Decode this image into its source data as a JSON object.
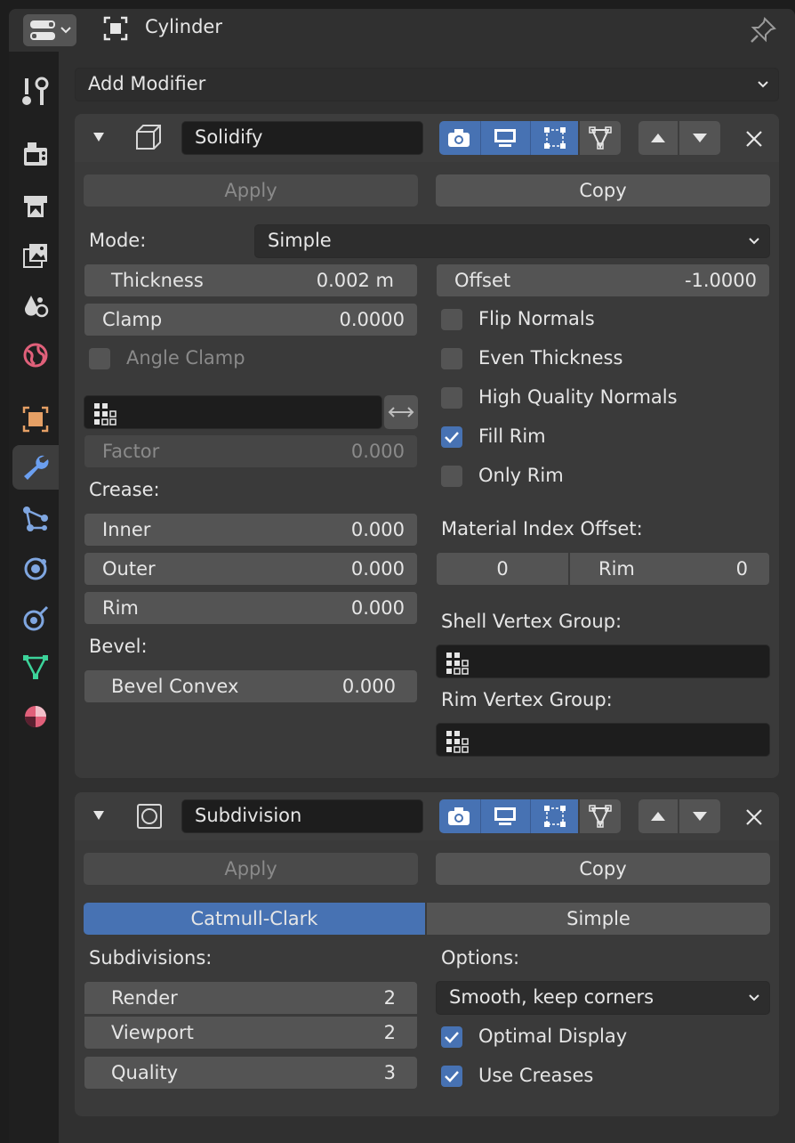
{
  "header": {
    "object_name": "Cylinder"
  },
  "add_modifier": {
    "label": "Add Modifier"
  },
  "solidify": {
    "name": "Solidify",
    "apply_label": "Apply",
    "copy_label": "Copy",
    "mode_label": "Mode:",
    "mode_value": "Simple",
    "thickness_label": "Thickness",
    "thickness_value": "0.002 m",
    "offset_label": "Offset",
    "offset_value": "-1.0000",
    "clamp_label": "Clamp",
    "clamp_value": "0.0000",
    "angle_clamp_label": "Angle Clamp",
    "flip_normals_label": "Flip Normals",
    "even_thickness_label": "Even Thickness",
    "high_quality_normals_label": "High Quality Normals",
    "fill_rim_label": "Fill Rim",
    "only_rim_label": "Only Rim",
    "factor_label": "Factor",
    "factor_value": "0.000",
    "crease_label": "Crease:",
    "inner_label": "Inner",
    "inner_value": "0.000",
    "outer_label": "Outer",
    "outer_value": "0.000",
    "rim_label": "Rim",
    "rim_value": "0.000",
    "bevel_label": "Bevel:",
    "bevel_convex_label": "Bevel Convex",
    "bevel_convex_value": "0.000",
    "material_index_offset_label": "Material Index Offset:",
    "material_offset_value": "0",
    "material_rim_label": "Rim",
    "material_rim_value": "0",
    "shell_vertex_group_label": "Shell Vertex Group:",
    "rim_vertex_group_label": "Rim Vertex Group:",
    "checkboxes": {
      "angle_clamp": false,
      "flip_normals": false,
      "even_thickness": false,
      "high_quality_normals": false,
      "fill_rim": true,
      "only_rim": false
    }
  },
  "subdivision": {
    "name": "Subdivision",
    "apply_label": "Apply",
    "copy_label": "Copy",
    "catmull_label": "Catmull-Clark",
    "simple_label": "Simple",
    "subdivisions_label": "Subdivisions:",
    "options_label": "Options:",
    "render_label": "Render",
    "render_value": "2",
    "viewport_label": "Viewport",
    "viewport_value": "2",
    "quality_label": "Quality",
    "quality_value": "3",
    "uv_smooth_value": "Smooth, keep corners",
    "optimal_display_label": "Optimal Display",
    "use_creases_label": "Use Creases",
    "checkboxes": {
      "optimal_display": true,
      "use_creases": true
    }
  },
  "colors": {
    "accent": "#4772b3",
    "panel": "#3a3a3a",
    "field": "#545454",
    "dark_field": "#1d1d1d"
  }
}
